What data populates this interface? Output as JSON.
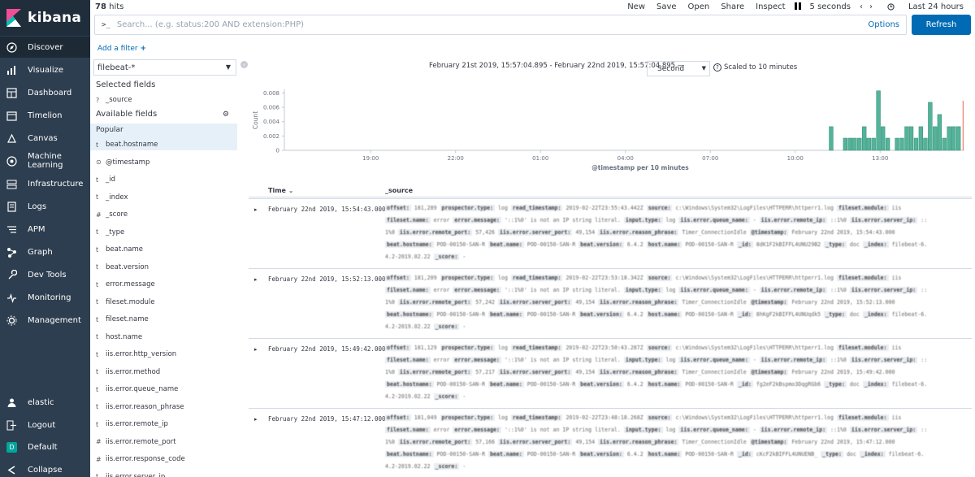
{
  "app": {
    "name": "kibana"
  },
  "nav": {
    "items": [
      {
        "label": "Discover",
        "icon": "compass-icon"
      },
      {
        "label": "Visualize",
        "icon": "visualize-icon"
      },
      {
        "label": "Dashboard",
        "icon": "dashboard-icon"
      },
      {
        "label": "Timelion",
        "icon": "timelion-icon"
      },
      {
        "label": "Canvas",
        "icon": "canvas-icon"
      },
      {
        "label": "Machine Learning",
        "icon": "machine-learning-icon"
      },
      {
        "label": "Infrastructure",
        "icon": "infrastructure-icon"
      },
      {
        "label": "Logs",
        "icon": "logs-icon"
      },
      {
        "label": "APM",
        "icon": "apm-icon"
      },
      {
        "label": "Graph",
        "icon": "graph-icon"
      },
      {
        "label": "Dev Tools",
        "icon": "wrench-icon"
      },
      {
        "label": "Monitoring",
        "icon": "heartbeat-icon"
      },
      {
        "label": "Management",
        "icon": "gear-icon"
      }
    ],
    "bottom": [
      {
        "label": "elastic",
        "icon": "user-icon"
      },
      {
        "label": "Logout",
        "icon": "logout-icon"
      },
      {
        "label": "Default",
        "badge": "D"
      },
      {
        "label": "Collapse",
        "icon": "collapse-icon"
      }
    ],
    "active_color": "#1d2a36",
    "background": "#2d3e50"
  },
  "topbar": {
    "hits_count": "78",
    "hits_label": "hits",
    "menu": [
      "New",
      "Save",
      "Open",
      "Share",
      "Inspect"
    ],
    "pause_icon": "pause-icon",
    "refresh_interval": "5 seconds",
    "time_range": "Last 24 hours"
  },
  "search": {
    "prompt": ">_",
    "placeholder": "Search... (e.g. status:200 AND extension:PHP)",
    "options_label": "Options",
    "refresh_label": "Refresh"
  },
  "filter": {
    "add_label": "Add a filter"
  },
  "sidebar": {
    "index_pattern": "filebeat-*",
    "selected_heading": "Selected fields",
    "selected": [
      {
        "type": "?",
        "name": "_source"
      }
    ],
    "available_heading": "Available fields",
    "popular_heading": "Popular",
    "fields": [
      {
        "type": "t",
        "name": "beat.hostname"
      },
      {
        "type": "⊙",
        "name": "@timestamp"
      },
      {
        "type": "t",
        "name": "_id"
      },
      {
        "type": "t",
        "name": "_index"
      },
      {
        "type": "#",
        "name": "_score"
      },
      {
        "type": "t",
        "name": "_type"
      },
      {
        "type": "t",
        "name": "beat.name"
      },
      {
        "type": "t",
        "name": "beat.version"
      },
      {
        "type": "t",
        "name": "error.message"
      },
      {
        "type": "t",
        "name": "fileset.module"
      },
      {
        "type": "t",
        "name": "fileset.name"
      },
      {
        "type": "t",
        "name": "host.name"
      },
      {
        "type": "t",
        "name": "iis.error.http_version"
      },
      {
        "type": "t",
        "name": "iis.error.method"
      },
      {
        "type": "t",
        "name": "iis.error.queue_name"
      },
      {
        "type": "t",
        "name": "iis.error.reason_phrase"
      },
      {
        "type": "t",
        "name": "iis.error.remote_ip"
      },
      {
        "type": "#",
        "name": "iis.error.remote_port"
      },
      {
        "type": "#",
        "name": "iis.error.response_code"
      },
      {
        "type": "t",
        "name": "iis.error.server_ip"
      }
    ]
  },
  "timerange": {
    "text": "February 21st 2019, 15:57:04.895 - February 22nd 2019, 15:57:04.895 —",
    "interval": "Second",
    "scaled_note": "Scaled to 10 minutes"
  },
  "chart_data": {
    "type": "bar",
    "ylabel": "Count",
    "xlabel": "@timestamp per 10 minutes",
    "y_ticks": [
      "0",
      "0.002",
      "0.004",
      "0.006",
      "0.008"
    ],
    "ylim": [
      0,
      0.0085
    ],
    "x_ticks": [
      "19:00",
      "22:00",
      "01:00",
      "04:00",
      "07:00",
      "10:00",
      "13:00"
    ],
    "x_tick_hours": [
      19,
      22,
      25,
      28,
      31,
      34,
      37
    ],
    "x_range_hours": [
      15.95,
      39.95
    ],
    "bar_width_hours": 0.1667,
    "bar_color": "#54b399",
    "bars": [
      {
        "h": 35.2,
        "v": 0.0033
      },
      {
        "h": 35.7,
        "v": 0.0017
      },
      {
        "h": 35.87,
        "v": 0.0017
      },
      {
        "h": 36.03,
        "v": 0.0017
      },
      {
        "h": 36.2,
        "v": 0.0017
      },
      {
        "h": 36.37,
        "v": 0.0033
      },
      {
        "h": 36.53,
        "v": 0.0017
      },
      {
        "h": 36.7,
        "v": 0.0017
      },
      {
        "h": 37.03,
        "v": 0.0033
      },
      {
        "h": 37.2,
        "v": 0.0017
      },
      {
        "h": 37.53,
        "v": 0.0017
      },
      {
        "h": 37.7,
        "v": 0.0017
      },
      {
        "h": 37.87,
        "v": 0.0033
      },
      {
        "h": 38.03,
        "v": 0.0033
      },
      {
        "h": 38.2,
        "v": 0.0017
      },
      {
        "h": 38.37,
        "v": 0.0033
      },
      {
        "h": 38.53,
        "v": 0.0017
      },
      {
        "h": 38.7,
        "v": 0.0017
      },
      {
        "h": 38.87,
        "v": 0.0033
      },
      {
        "h": 39.03,
        "v": 0.005
      },
      {
        "h": 39.2,
        "v": 0.0017
      },
      {
        "h": 39.37,
        "v": 0.0033
      },
      {
        "h": 39.53,
        "v": 0.0033
      },
      {
        "h": 39.7,
        "v": 0.0033
      },
      {
        "h": 36.87,
        "v": 0.0083
      },
      {
        "h": 38.7,
        "v": 0.0067
      }
    ],
    "current_time_marker_hours": 39.93
  },
  "documents": {
    "header": {
      "time_label": "Time",
      "source_label": "_source"
    },
    "rows": [
      {
        "time": "February 22nd 2019, 15:54:43.000",
        "preview": [
          "offset: 181,289  prospector.type: log  read_timestamp: 2019-02-22T23:55:43.442Z  source: c:\\Windows\\System32\\LogFiles\\HTTPERR\\httperr1.log  fileset.module: iis",
          "fileset.name: error  error.message: '::1%0' is not an IP string literal.  input.type: log  iis.error.queue_name: -  iis.error.remote_ip: ::1%0  iis.error.server_ip: ::",
          "1%0  iis.error.remote_port: 57,426  iis.error.server_port: 49,154  iis.error.reason_phrase: Timer_ConnectionIdle  @timestamp: February 22nd 2019, 15:54:43.000",
          "beat.hostname: POD-00150-SAN-R  beat.name: POD-00150-SAN-R  beat.version: 6.4.2  host.name: POD-00150-SAN-R  _id: 8dK1F2kBIFFL4UNU29B2  _type: doc  _index: filebeat-6.",
          "4.2-2019.02.22  _score: -"
        ]
      },
      {
        "time": "February 22nd 2019, 15:52:13.000",
        "preview": [
          "offset: 181,209  prospector.type: log  read_timestamp: 2019-02-22T23:53:18.342Z  source: c:\\Windows\\System32\\LogFiles\\HTTPERR\\httperr1.log  fileset.module: iis",
          "fileset.name: error  error.message: '::1%0' is not an IP string literal.  input.type: log  iis.error.queue_name: -  iis.error.remote_ip: ::1%0  iis.error.server_ip: ::",
          "1%0  iis.error.remote_port: 57,242  iis.error.server_port: 49,154  iis.error.reason_phrase: Timer_ConnectionIdle  @timestamp: February 22nd 2019, 15:52:13.000",
          "beat.hostname: POD-00150-SAN-R  beat.name: POD-00150-SAN-R  beat.version: 6.4.2  host.name: POD-00150-SAN-R  _id: 8hKgF2kBIFFL4UNUqdk5  _type: doc  _index: filebeat-6.",
          "4.2-2019.02.22  _score: -"
        ]
      },
      {
        "time": "February 22nd 2019, 15:49:42.000",
        "preview": [
          "offset: 181,129  prospector.type: log  read_timestamp: 2019-02-22T23:50:43.287Z  source: c:\\Windows\\System32\\LogFiles\\HTTPERR\\httperr1.log  fileset.module: iis",
          "fileset.name: error  error.message: '::1%0' is not an IP string literal.  input.type: log  iis.error.queue_name: -  iis.error.remote_ip: ::1%0  iis.error.server_ip: ::",
          "1%0  iis.error.remote_port: 57,217  iis.error.server_port: 49,154  iis.error.reason_phrase: Timer_ConnectionIdle  @timestamp: February 22nd 2019, 15:49:42.000",
          "beat.hostname: POD-00150-SAN-R  beat.name: POD-00150-SAN-R  beat.version: 6.4.2  host.name: POD-00150-SAN-R  _id: fg2eF2kBspmo3DqgRGb6  _type: doc  _index: filebeat-6.",
          "4.2-2019.02.22  _score: -"
        ]
      },
      {
        "time": "February 22nd 2019, 15:47:12.000",
        "preview": [
          "offset: 181,049  prospector.type: log  read_timestamp: 2019-02-22T23:48:18.268Z  source: c:\\Windows\\System32\\LogFiles\\HTTPERR\\httperr1.log  fileset.module: iis",
          "fileset.name: error  error.message: '::1%0' is not an IP string literal.  input.type: log  iis.error.queue_name: -  iis.error.remote_ip: ::1%0  iis.error.server_ip: ::",
          "1%0  iis.error.remote_port: 57,166  iis.error.server_port: 49,154  iis.error.reason_phrase: Timer_ConnectionIdle  @timestamp: February 22nd 2019, 15:47:12.000",
          "beat.hostname: POD-00150-SAN-R  beat.name: POD-00150-SAN-R  beat.version: 6.4.2  host.name: POD-00150-SAN-R  _id: cKcF2kBIFFL4UNUENB_  _type: doc  _index: filebeat-6.",
          "4.2-2019.02.22  _score: -"
        ]
      }
    ]
  }
}
